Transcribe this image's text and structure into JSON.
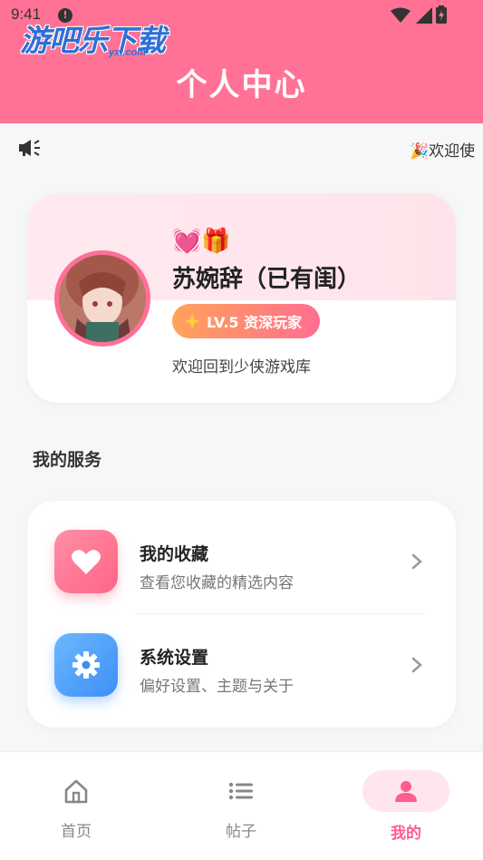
{
  "status_bar": {
    "time": "9:41",
    "notification_badge": "!"
  },
  "watermark": {
    "text": "游吧乐下载",
    "sub": "yxl.com"
  },
  "header": {
    "title": "个人中心"
  },
  "announcement": {
    "text": "🎉欢迎使"
  },
  "profile": {
    "name_prefix_emoji": "💓🎁",
    "name": "苏婉辞（已有闺）",
    "level_badge": "LV.5 资深玩家",
    "welcome": "欢迎回到少侠游戏库"
  },
  "services": {
    "title": "我的服务",
    "items": [
      {
        "label": "我的收藏",
        "desc": "查看您收藏的精选内容",
        "icon": "heart-icon"
      },
      {
        "label": "系统设置",
        "desc": "偏好设置、主题与关于",
        "icon": "gear-icon"
      }
    ]
  },
  "bottom_nav": [
    {
      "label": "首页",
      "icon": "home-icon"
    },
    {
      "label": "帖子",
      "icon": "list-icon"
    },
    {
      "label": "我的",
      "icon": "person-icon",
      "active": true
    }
  ],
  "colors": {
    "brand": "#ff7296",
    "accent": "#ff5d8c",
    "settings_blue": "#3d8ff5"
  }
}
